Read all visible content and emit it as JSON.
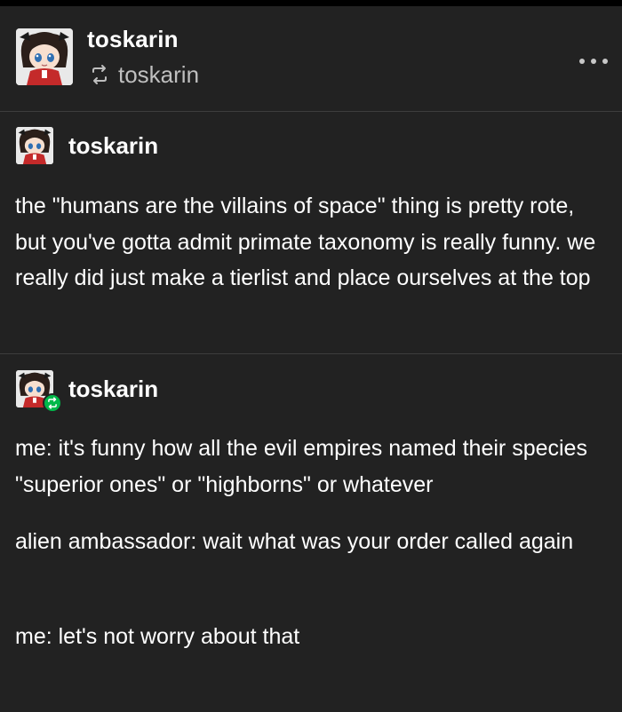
{
  "header": {
    "blog_name": "toskarin",
    "reblog_from": "toskarin"
  },
  "trail": [
    {
      "blog_name": "toskarin",
      "text": "the \"humans are the villains of space\" thing is pretty rote, but you've gotta admit primate taxonomy is really funny. we really did just make a tierlist and place ourselves at the top"
    },
    {
      "blog_name": "toskarin",
      "paragraphs": [
        "me: it's funny how all the evil empires named their species \"superior ones\" or \"highborns\" or whatever",
        "alien ambassador: wait what was your order called again",
        "me: let's not worry about that"
      ]
    }
  ],
  "colors": {
    "background": "#222222",
    "text": "#ffffff",
    "muted": "#bfbfbf",
    "divider": "#3d3d3d",
    "reblog_badge": "#00b84a"
  },
  "icons": {
    "reblog": "reblog-icon",
    "more": "more-options-icon",
    "avatar": "avatar"
  }
}
